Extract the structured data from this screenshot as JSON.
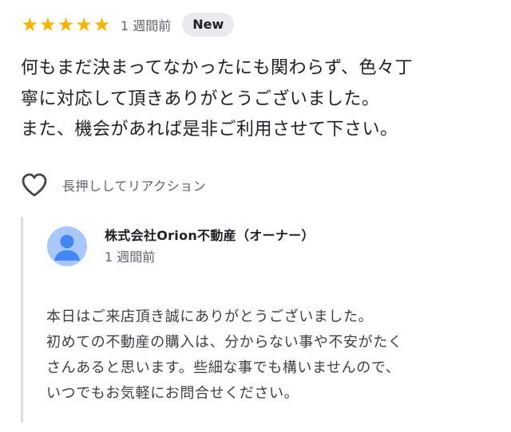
{
  "review": {
    "rating": 5,
    "stars": [
      "★",
      "★",
      "★",
      "★",
      "★"
    ],
    "date": "1 週間前",
    "badge": "New",
    "text": "何もまだ決まってなかったにも関わらず、色々丁\n寧に対応して頂きありがとうございました。\nまた、機会があれば是非ご利用させて下さい。"
  },
  "reaction": {
    "icon": "heart-outline-icon",
    "label": "長押ししてリアクション"
  },
  "owner_reply": {
    "avatar_icon": "person-avatar-icon",
    "name": "株式会社Orion不動産（オーナー）",
    "date": "1 週間前",
    "text": "本日はご来店頂き誠にありがとうございました。\n初めての不動産の購入は、分からない事や不安がたく\nさんあると思います。些細な事でも構いませんので、\nいつでもお気軽にお問合せください。"
  },
  "colors": {
    "star": "#f6b400",
    "badge_bg": "#e8eaed",
    "avatar_bg": "#a8c7fa",
    "avatar_fg": "#4285f4",
    "reply_border": "#dadce0"
  }
}
